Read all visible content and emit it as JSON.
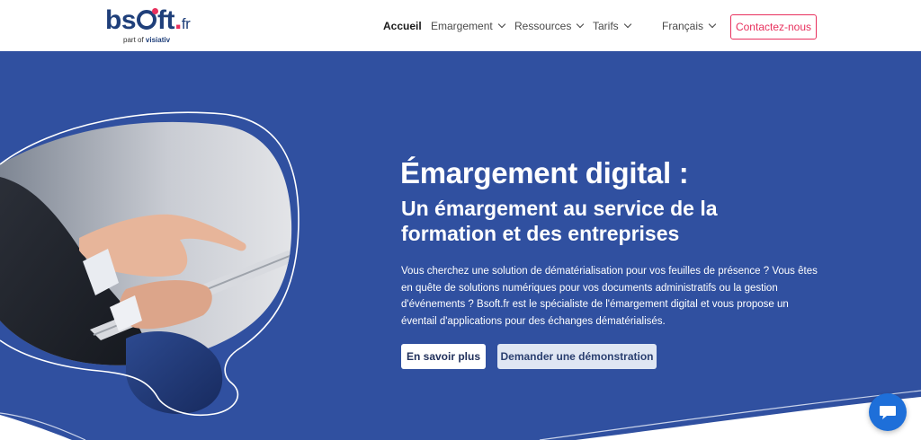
{
  "logo": {
    "main": "bs",
    "dot": ".",
    "tld": "fr",
    "sub_prefix": "part of ",
    "sub_brand": "visiativ"
  },
  "nav": {
    "items": [
      {
        "label": "Accueil",
        "active": true,
        "dropdown": false
      },
      {
        "label": "Emargement",
        "active": false,
        "dropdown": true
      },
      {
        "label": "Ressources",
        "active": false,
        "dropdown": true
      },
      {
        "label": "Tarifs",
        "active": false,
        "dropdown": true
      }
    ],
    "language": "Français",
    "contact_label": "Contactez-nous"
  },
  "hero": {
    "title": "Émargement digital :",
    "subtitle": "Un émargement au service de la formation et des entreprises",
    "description": "Vous cherchez une solution de dématérialisation pour vos feuilles de présence ? Vous êtes en quête de solutions numériques pour vos documents administratifs ou la gestion d'événements ? Bsoft.fr est le spécialiste de l'émargement digital et vous propose un éventail d'applications pour des échanges dématérialisés.",
    "primary_button": "En savoir plus",
    "secondary_button": "Demander une démonstration"
  },
  "colors": {
    "brand_blue": "#1f3f7a",
    "hero_bg": "#3050a0",
    "accent_pink": "#e8305d",
    "chat_blue": "#1e6fd9"
  },
  "icons": {
    "chat": "chat-bubble-icon",
    "dropdown": "chevron-down-icon"
  }
}
